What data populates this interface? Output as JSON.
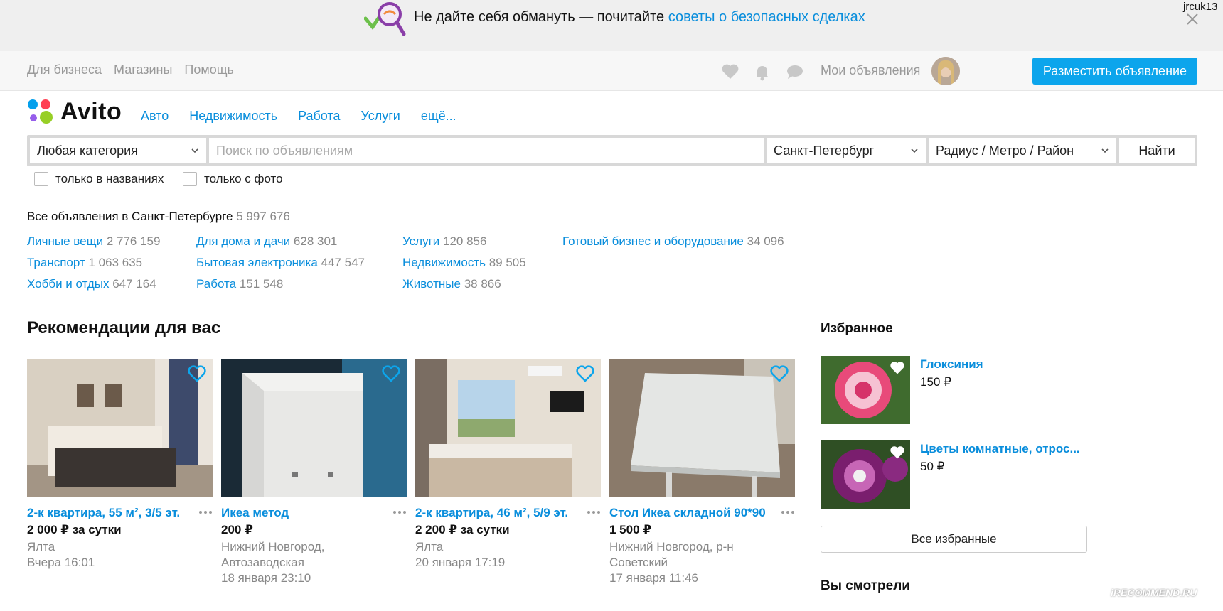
{
  "banner": {
    "text": "Не дайте себя обмануть — почитайте ",
    "link": "советы о безопасных сделках",
    "username": "jrcuk13"
  },
  "topbar": {
    "links": [
      "Для бизнеса",
      "Магазины",
      "Помощь"
    ],
    "my_ads": "Мои объявления",
    "post_button": "Разместить объявление",
    "icons": [
      "heart-icon",
      "bell-icon",
      "chat-icon"
    ]
  },
  "header": {
    "logo": "Avito",
    "nav": [
      "Авто",
      "Недвижимость",
      "Работа",
      "Услуги",
      "ещё..."
    ]
  },
  "search": {
    "category": "Любая категория",
    "placeholder": "Поиск по объявлениям",
    "city": "Санкт-Петербург",
    "radius": "Радиус / Метро / Район",
    "find_button": "Найти",
    "checkbox_titles": "только в названиях",
    "checkbox_photo": "только с фото"
  },
  "summary": {
    "label": "Все объявления в Санкт-Петербурге",
    "count": "5 997 676"
  },
  "categories": [
    {
      "name": "Личные вещи",
      "count": "2 776 159"
    },
    {
      "name": "Транспорт",
      "count": "1 063 635"
    },
    {
      "name": "Хобби и отдых",
      "count": "647 164"
    },
    {
      "name": "Для дома и дачи",
      "count": "628 301"
    },
    {
      "name": "Бытовая электроника",
      "count": "447 547"
    },
    {
      "name": "Работа",
      "count": "151 548"
    },
    {
      "name": "Услуги",
      "count": "120 856"
    },
    {
      "name": "Недвижимость",
      "count": "89 505"
    },
    {
      "name": "Животные",
      "count": "38 866"
    },
    {
      "name": "Готовый бизнес и оборудование",
      "count": "34 096"
    }
  ],
  "recommendations": {
    "heading": "Рекомендации для вас",
    "items": [
      {
        "title": "2-к квартира, 55 м², 3/5 эт.",
        "price": "2 000 ₽ за сутки",
        "location": "Ялта",
        "date": "Вчера 16:01"
      },
      {
        "title": "Икеа метод",
        "price": "200 ₽",
        "location": "Нижний Новгород, Автозаводская",
        "date": "18 января 23:10"
      },
      {
        "title": "2-к квартира, 46 м², 5/9 эт.",
        "price": "2 200 ₽ за сутки",
        "location": "Ялта",
        "date": "20 января 17:19"
      },
      {
        "title": "Стол Икеа складной 90*90",
        "price": "1 500 ₽",
        "location": "Нижний Новгород, р-н Советский",
        "date": "17 января 11:46"
      }
    ]
  },
  "favorites": {
    "heading": "Избранное",
    "items": [
      {
        "title": "Глоксиния",
        "price": "150 ₽"
      },
      {
        "title": "Цветы комнатные, отрос...",
        "price": "50 ₽"
      }
    ],
    "all_button": "Все избранные"
  },
  "viewed": {
    "heading": "Вы смотрели"
  },
  "watermark": "iRECOMMEND.RU",
  "colors": {
    "accent": "#0a8edc",
    "button": "#0ca5ec"
  }
}
